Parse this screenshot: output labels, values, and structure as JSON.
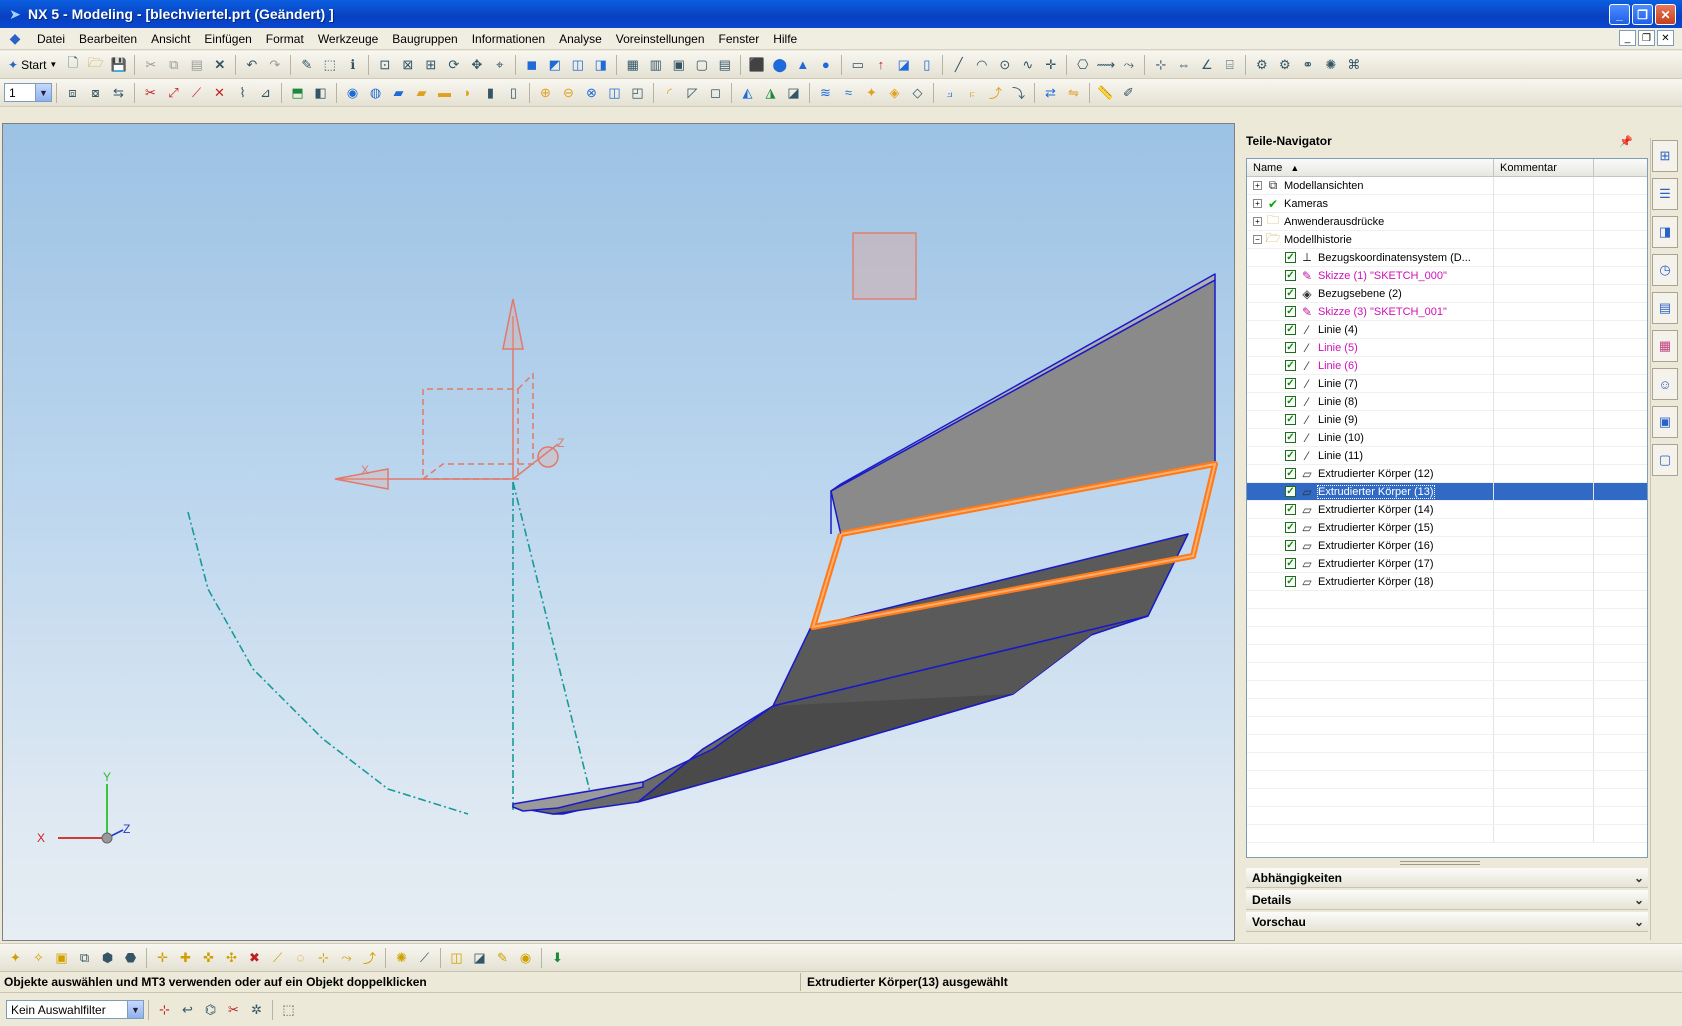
{
  "window": {
    "title": "NX 5 - Modeling - [blechviertel.prt (Geändert) ]",
    "minimize": "_",
    "restore": "❐",
    "close": "✕"
  },
  "menu": {
    "items": [
      "Datei",
      "Bearbeiten",
      "Ansicht",
      "Einfügen",
      "Format",
      "Werkzeuge",
      "Baugruppen",
      "Informationen",
      "Analyse",
      "Voreinstellungen",
      "Fenster",
      "Hilfe"
    ]
  },
  "toolbar": {
    "start_label": "Start",
    "layer_value": "1"
  },
  "graphics": {
    "triad": {
      "x_label": "X",
      "y_label": "Y",
      "z_label": "Z"
    },
    "datum_csys": {
      "x_label": "X",
      "z_label": "Z"
    }
  },
  "navigator": {
    "title": "Teile-Navigator",
    "col_name": "Name",
    "col_comment": "Kommentar",
    "nodes": [
      {
        "label": "Modellansichten",
        "level": 0,
        "expander": "+",
        "icon": "model-views-icon",
        "glyph": "⧉",
        "magenta": false,
        "selected": false
      },
      {
        "label": "Kameras",
        "level": 0,
        "expander": "+",
        "icon": "camera-icon",
        "glyph": "✔",
        "magenta": false,
        "selected": false
      },
      {
        "label": "Anwenderausdrücke",
        "level": 0,
        "expander": "+",
        "icon": "folder-icon",
        "glyph": "🗀",
        "magenta": false,
        "selected": false
      },
      {
        "label": "Modellhistorie",
        "level": 0,
        "expander": "−",
        "icon": "folder-open-icon",
        "glyph": "🗁",
        "magenta": false,
        "selected": false
      },
      {
        "label": "Bezugskoordinatensystem (D...",
        "level": 1,
        "icon": "datum-csys-icon",
        "glyph": "⟂",
        "magenta": false,
        "selected": false
      },
      {
        "label": "Skizze (1) \"SKETCH_000\"",
        "level": 1,
        "icon": "sketch-icon",
        "glyph": "✎",
        "magenta": true,
        "selected": false
      },
      {
        "label": "Bezugsebene (2)",
        "level": 1,
        "icon": "datum-plane-icon",
        "glyph": "◈",
        "magenta": false,
        "selected": false
      },
      {
        "label": "Skizze (3) \"SKETCH_001\"",
        "level": 1,
        "icon": "sketch-icon",
        "glyph": "✎",
        "magenta": true,
        "selected": false
      },
      {
        "label": "Linie (4)",
        "level": 1,
        "icon": "line-icon",
        "glyph": "⁄",
        "magenta": false,
        "selected": false
      },
      {
        "label": "Linie (5)",
        "level": 1,
        "icon": "line-icon",
        "glyph": "⁄",
        "magenta": true,
        "selected": false
      },
      {
        "label": "Linie (6)",
        "level": 1,
        "icon": "line-icon",
        "glyph": "⁄",
        "magenta": true,
        "selected": false
      },
      {
        "label": "Linie (7)",
        "level": 1,
        "icon": "line-icon",
        "glyph": "⁄",
        "magenta": false,
        "selected": false
      },
      {
        "label": "Linie (8)",
        "level": 1,
        "icon": "line-icon",
        "glyph": "⁄",
        "magenta": false,
        "selected": false
      },
      {
        "label": "Linie (9)",
        "level": 1,
        "icon": "line-icon",
        "glyph": "⁄",
        "magenta": false,
        "selected": false
      },
      {
        "label": "Linie (10)",
        "level": 1,
        "icon": "line-icon",
        "glyph": "⁄",
        "magenta": false,
        "selected": false
      },
      {
        "label": "Linie (11)",
        "level": 1,
        "icon": "line-icon",
        "glyph": "⁄",
        "magenta": false,
        "selected": false
      },
      {
        "label": "Extrudierter Körper (12)",
        "level": 1,
        "icon": "extrude-icon",
        "glyph": "▱",
        "magenta": false,
        "selected": false
      },
      {
        "label": "Extrudierter Körper (13)",
        "level": 1,
        "icon": "extrude-icon",
        "glyph": "▱",
        "magenta": false,
        "selected": true
      },
      {
        "label": "Extrudierter Körper (14)",
        "level": 1,
        "icon": "extrude-icon",
        "glyph": "▱",
        "magenta": false,
        "selected": false
      },
      {
        "label": "Extrudierter Körper (15)",
        "level": 1,
        "icon": "extrude-icon",
        "glyph": "▱",
        "magenta": false,
        "selected": false
      },
      {
        "label": "Extrudierter Körper (16)",
        "level": 1,
        "icon": "extrude-icon",
        "glyph": "▱",
        "magenta": false,
        "selected": false
      },
      {
        "label": "Extrudierter Körper (17)",
        "level": 1,
        "icon": "extrude-icon",
        "glyph": "▱",
        "magenta": false,
        "selected": false
      },
      {
        "label": "Extrudierter Körper (18)",
        "level": 1,
        "icon": "extrude-icon",
        "glyph": "▱",
        "magenta": false,
        "selected": false
      }
    ],
    "sections": [
      "Abhängigkeiten",
      "Details",
      "Vorschau"
    ]
  },
  "status": {
    "prompt": "Objekte auswählen und MT3 verwenden oder auf ein Objekt doppelklicken",
    "message": "Extrudierter Körper(13) ausgewählt"
  },
  "selection": {
    "filter_value": "Kein Auswahlfilter"
  },
  "colors": {
    "selection_highlight": "#ff7a1a",
    "tree_selected": "#316ac5",
    "sketch_magenta": "#d010b8",
    "curve_teal": "#1a9a9a"
  }
}
